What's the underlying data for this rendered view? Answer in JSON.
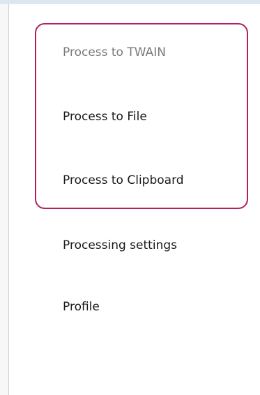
{
  "menu": {
    "items": [
      {
        "label": "Process to TWAIN",
        "enabled": false
      },
      {
        "label": "Process to File",
        "enabled": true
      },
      {
        "label": "Process to Clipboard",
        "enabled": true
      },
      {
        "label": "Processing settings",
        "enabled": true
      },
      {
        "label": "Profile",
        "enabled": true
      }
    ],
    "highlight_color": "#b51f5d"
  }
}
